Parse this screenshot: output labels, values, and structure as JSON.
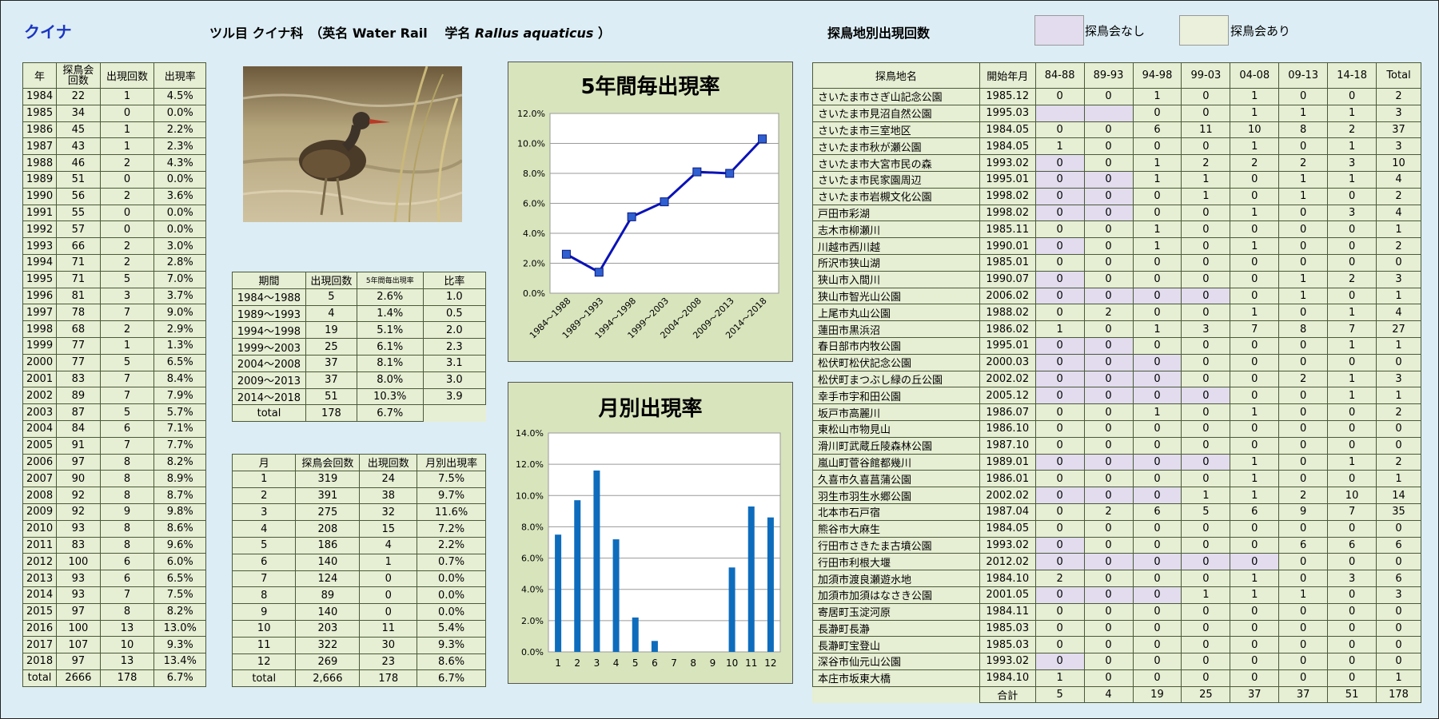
{
  "species_name": "クイナ",
  "header_prefix": "ツル目 クイナ科　（英名 Water Rail　 学名 ",
  "scientific_name": "Rallus aquaticus",
  "header_suffix": " ）",
  "site_section_title": "探鳥地別出現回数",
  "legend": {
    "no_event": "探鳥会なし",
    "event": "探鳥会あり",
    "no_event_color": "#e2dcee",
    "event_color": "#eaf0dc"
  },
  "photo_alt": "Water Rail photo",
  "year_table": {
    "headers": [
      "年",
      "探鳥会回数",
      "出現回数",
      "出現率"
    ],
    "rows": [
      [
        "1984",
        "22",
        "1",
        "4.5%"
      ],
      [
        "1985",
        "34",
        "0",
        "0.0%"
      ],
      [
        "1986",
        "45",
        "1",
        "2.2%"
      ],
      [
        "1987",
        "43",
        "1",
        "2.3%"
      ],
      [
        "1988",
        "46",
        "2",
        "4.3%"
      ],
      [
        "1989",
        "51",
        "0",
        "0.0%"
      ],
      [
        "1990",
        "56",
        "2",
        "3.6%"
      ],
      [
        "1991",
        "55",
        "0",
        "0.0%"
      ],
      [
        "1992",
        "57",
        "0",
        "0.0%"
      ],
      [
        "1993",
        "66",
        "2",
        "3.0%"
      ],
      [
        "1994",
        "71",
        "2",
        "2.8%"
      ],
      [
        "1995",
        "71",
        "5",
        "7.0%"
      ],
      [
        "1996",
        "81",
        "3",
        "3.7%"
      ],
      [
        "1997",
        "78",
        "7",
        "9.0%"
      ],
      [
        "1998",
        "68",
        "2",
        "2.9%"
      ],
      [
        "1999",
        "77",
        "1",
        "1.3%"
      ],
      [
        "2000",
        "77",
        "5",
        "6.5%"
      ],
      [
        "2001",
        "83",
        "7",
        "8.4%"
      ],
      [
        "2002",
        "89",
        "7",
        "7.9%"
      ],
      [
        "2003",
        "87",
        "5",
        "5.7%"
      ],
      [
        "2004",
        "84",
        "6",
        "7.1%"
      ],
      [
        "2005",
        "91",
        "7",
        "7.7%"
      ],
      [
        "2006",
        "97",
        "8",
        "8.2%"
      ],
      [
        "2007",
        "90",
        "8",
        "8.9%"
      ],
      [
        "2008",
        "92",
        "8",
        "8.7%"
      ],
      [
        "2009",
        "92",
        "9",
        "9.8%"
      ],
      [
        "2010",
        "93",
        "8",
        "8.6%"
      ],
      [
        "2011",
        "83",
        "8",
        "9.6%"
      ],
      [
        "2012",
        "100",
        "6",
        "6.0%"
      ],
      [
        "2013",
        "93",
        "6",
        "6.5%"
      ],
      [
        "2014",
        "93",
        "7",
        "7.5%"
      ],
      [
        "2015",
        "97",
        "8",
        "8.2%"
      ],
      [
        "2016",
        "100",
        "13",
        "13.0%"
      ],
      [
        "2017",
        "107",
        "10",
        "9.3%"
      ],
      [
        "2018",
        "97",
        "13",
        "13.4%"
      ]
    ],
    "total": [
      "total",
      "2666",
      "178",
      "6.7%"
    ]
  },
  "period_table": {
    "headers": [
      "期間",
      "出現回数",
      "5年間毎出現率",
      "比率"
    ],
    "rows": [
      [
        "1984～1988",
        "5",
        "2.6%",
        "1.0"
      ],
      [
        "1989～1993",
        "4",
        "1.4%",
        "0.5"
      ],
      [
        "1994～1998",
        "19",
        "5.1%",
        "2.0"
      ],
      [
        "1999～2003",
        "25",
        "6.1%",
        "2.3"
      ],
      [
        "2004～2008",
        "37",
        "8.1%",
        "3.1"
      ],
      [
        "2009～2013",
        "37",
        "8.0%",
        "3.0"
      ],
      [
        "2014～2018",
        "51",
        "10.3%",
        "3.9"
      ]
    ],
    "total": [
      "total",
      "178",
      "6.7%"
    ]
  },
  "month_table": {
    "headers": [
      "月",
      "探鳥会回数",
      "出現回数",
      "月別出現率"
    ],
    "rows": [
      [
        "1",
        "319",
        "24",
        "7.5%"
      ],
      [
        "2",
        "391",
        "38",
        "9.7%"
      ],
      [
        "3",
        "275",
        "32",
        "11.6%"
      ],
      [
        "4",
        "208",
        "15",
        "7.2%"
      ],
      [
        "5",
        "186",
        "4",
        "2.2%"
      ],
      [
        "6",
        "140",
        "1",
        "0.7%"
      ],
      [
        "7",
        "124",
        "0",
        "0.0%"
      ],
      [
        "8",
        "89",
        "0",
        "0.0%"
      ],
      [
        "9",
        "140",
        "0",
        "0.0%"
      ],
      [
        "10",
        "203",
        "11",
        "5.4%"
      ],
      [
        "11",
        "322",
        "30",
        "9.3%"
      ],
      [
        "12",
        "269",
        "23",
        "8.6%"
      ]
    ],
    "total": [
      "total",
      "2,666",
      "178",
      "6.7%"
    ]
  },
  "site_table": {
    "headers": [
      "探鳥地名",
      "開始年月",
      "84-88",
      "89-93",
      "94-98",
      "99-03",
      "04-08",
      "09-13",
      "14-18",
      "Total"
    ],
    "rows": [
      {
        "c": [
          "さいたま市さぎ山記念公園",
          "1985.12",
          "0",
          "0",
          "1",
          "0",
          "1",
          "0",
          "0",
          "2"
        ],
        "lav": []
      },
      {
        "c": [
          "さいたま市見沼自然公園",
          "1995.03",
          "",
          "",
          "0",
          "0",
          "1",
          "1",
          "1",
          "3"
        ],
        "lav": [
          2,
          3
        ]
      },
      {
        "c": [
          "さいたま市三室地区",
          "1984.05",
          "0",
          "0",
          "6",
          "11",
          "10",
          "8",
          "2",
          "37"
        ],
        "lav": []
      },
      {
        "c": [
          "さいたま市秋が瀬公園",
          "1984.05",
          "1",
          "0",
          "0",
          "0",
          "1",
          "0",
          "1",
          "3"
        ],
        "lav": []
      },
      {
        "c": [
          "さいたま市大宮市民の森",
          "1993.02",
          "0",
          "0",
          "1",
          "2",
          "2",
          "2",
          "3",
          "10"
        ],
        "lav": [
          2
        ]
      },
      {
        "c": [
          "さいたま市民家園周辺",
          "1995.01",
          "0",
          "0",
          "1",
          "1",
          "0",
          "1",
          "1",
          "4"
        ],
        "lav": [
          2,
          3
        ]
      },
      {
        "c": [
          "さいたま市岩槻文化公園",
          "1998.02",
          "0",
          "0",
          "0",
          "1",
          "0",
          "1",
          "0",
          "2"
        ],
        "lav": [
          2,
          3
        ]
      },
      {
        "c": [
          "戸田市彩湖",
          "1998.02",
          "0",
          "0",
          "0",
          "0",
          "1",
          "0",
          "3",
          "4"
        ],
        "lav": [
          2,
          3
        ]
      },
      {
        "c": [
          "志木市柳瀬川",
          "1985.11",
          "0",
          "0",
          "1",
          "0",
          "0",
          "0",
          "0",
          "1"
        ],
        "lav": []
      },
      {
        "c": [
          "川越市西川越",
          "1990.01",
          "0",
          "0",
          "1",
          "0",
          "1",
          "0",
          "0",
          "2"
        ],
        "lav": [
          2
        ]
      },
      {
        "c": [
          "所沢市狭山湖",
          "1985.01",
          "0",
          "0",
          "0",
          "0",
          "0",
          "0",
          "0",
          "0"
        ],
        "lav": []
      },
      {
        "c": [
          "狭山市入間川",
          "1990.07",
          "0",
          "0",
          "0",
          "0",
          "0",
          "1",
          "2",
          "3"
        ],
        "lav": [
          2
        ]
      },
      {
        "c": [
          "狭山市智光山公園",
          "2006.02",
          "0",
          "0",
          "0",
          "0",
          "0",
          "1",
          "0",
          "1"
        ],
        "lav": [
          2,
          3,
          4,
          5
        ]
      },
      {
        "c": [
          "上尾市丸山公園",
          "1988.02",
          "0",
          "2",
          "0",
          "0",
          "1",
          "0",
          "1",
          "4"
        ],
        "lav": []
      },
      {
        "c": [
          "蓮田市黒浜沼",
          "1986.02",
          "1",
          "0",
          "1",
          "3",
          "7",
          "8",
          "7",
          "27"
        ],
        "lav": []
      },
      {
        "c": [
          "春日部市内牧公園",
          "1995.01",
          "0",
          "0",
          "0",
          "0",
          "0",
          "0",
          "1",
          "1"
        ],
        "lav": [
          2,
          3
        ]
      },
      {
        "c": [
          "松伏町松伏記念公園",
          "2000.03",
          "0",
          "0",
          "0",
          "0",
          "0",
          "0",
          "0",
          "0"
        ],
        "lav": [
          2,
          3,
          4
        ]
      },
      {
        "c": [
          "松伏町まつぶし緑の丘公園",
          "2002.02",
          "0",
          "0",
          "0",
          "0",
          "0",
          "2",
          "1",
          "3"
        ],
        "lav": [
          2,
          3,
          4
        ]
      },
      {
        "c": [
          "幸手市宇和田公園",
          "2005.12",
          "0",
          "0",
          "0",
          "0",
          "0",
          "0",
          "1",
          "1"
        ],
        "lav": [
          2,
          3,
          4,
          5
        ]
      },
      {
        "c": [
          "坂戸市高麗川",
          "1986.07",
          "0",
          "0",
          "1",
          "0",
          "1",
          "0",
          "0",
          "2"
        ],
        "lav": []
      },
      {
        "c": [
          "東松山市物見山",
          "1986.10",
          "0",
          "0",
          "0",
          "0",
          "0",
          "0",
          "0",
          "0"
        ],
        "lav": []
      },
      {
        "c": [
          "滑川町武蔵丘陵森林公園",
          "1987.10",
          "0",
          "0",
          "0",
          "0",
          "0",
          "0",
          "0",
          "0"
        ],
        "lav": []
      },
      {
        "c": [
          "嵐山町菅谷館都幾川",
          "1989.01",
          "0",
          "0",
          "0",
          "0",
          "1",
          "0",
          "1",
          "2"
        ],
        "lav": [
          2,
          3,
          4,
          5
        ]
      },
      {
        "c": [
          "久喜市久喜菖蒲公園",
          "1986.01",
          "0",
          "0",
          "0",
          "0",
          "1",
          "0",
          "0",
          "1"
        ],
        "lav": []
      },
      {
        "c": [
          "羽生市羽生水郷公園",
          "2002.02",
          "0",
          "0",
          "0",
          "1",
          "1",
          "2",
          "10",
          "14"
        ],
        "lav": [
          2,
          3,
          4
        ]
      },
      {
        "c": [
          "北本市石戸宿",
          "1987.04",
          "0",
          "2",
          "6",
          "5",
          "6",
          "9",
          "7",
          "35"
        ],
        "lav": []
      },
      {
        "c": [
          "熊谷市大麻生",
          "1984.05",
          "0",
          "0",
          "0",
          "0",
          "0",
          "0",
          "0",
          "0"
        ],
        "lav": []
      },
      {
        "c": [
          "行田市さきたま古墳公園",
          "1993.02",
          "0",
          "0",
          "0",
          "0",
          "0",
          "6",
          "6",
          "6"
        ],
        "lav": [
          2
        ]
      },
      {
        "c": [
          "行田市利根大堰",
          "2012.02",
          "0",
          "0",
          "0",
          "0",
          "0",
          "0",
          "0",
          "0"
        ],
        "lav": [
          2,
          3,
          4,
          5,
          6
        ]
      },
      {
        "c": [
          "加須市渡良瀬遊水地",
          "1984.10",
          "2",
          "0",
          "0",
          "0",
          "1",
          "0",
          "3",
          "6"
        ],
        "lav": []
      },
      {
        "c": [
          "加須市加須はなさき公園",
          "2001.05",
          "0",
          "0",
          "0",
          "1",
          "1",
          "1",
          "0",
          "3"
        ],
        "lav": [
          2,
          3,
          4
        ]
      },
      {
        "c": [
          "寄居町玉淀河原",
          "1984.11",
          "0",
          "0",
          "0",
          "0",
          "0",
          "0",
          "0",
          "0"
        ],
        "lav": []
      },
      {
        "c": [
          "長瀞町長瀞",
          "1985.03",
          "0",
          "0",
          "0",
          "0",
          "0",
          "0",
          "0",
          "0"
        ],
        "lav": []
      },
      {
        "c": [
          "長瀞町宝登山",
          "1985.03",
          "0",
          "0",
          "0",
          "0",
          "0",
          "0",
          "0",
          "0"
        ],
        "lav": []
      },
      {
        "c": [
          "深谷市仙元山公園",
          "1993.02",
          "0",
          "0",
          "0",
          "0",
          "0",
          "0",
          "0",
          "0"
        ],
        "lav": [
          2
        ]
      },
      {
        "c": [
          "本庄市坂東大橋",
          "1984.10",
          "1",
          "0",
          "0",
          "0",
          "0",
          "0",
          "0",
          "1"
        ],
        "lav": []
      }
    ],
    "total": [
      "合計",
      "5",
      "4",
      "19",
      "25",
      "37",
      "37",
      "51",
      "178"
    ]
  },
  "chart_data": [
    {
      "type": "line",
      "title": "5年間毎出現率",
      "categories": [
        "1984～1988",
        "1989～1993",
        "1994～1998",
        "1999～2003",
        "2004～2008",
        "2009～2013",
        "2014～2018"
      ],
      "values": [
        2.6,
        1.4,
        5.1,
        6.1,
        8.1,
        8.0,
        10.3
      ],
      "ylim": [
        0,
        12
      ],
      "ytick_step": 2,
      "yticks_format": "percent1",
      "color": "#0a12b8",
      "grid": true
    },
    {
      "type": "bar",
      "title": "月別出現率",
      "categories": [
        "1",
        "2",
        "3",
        "4",
        "5",
        "6",
        "7",
        "8",
        "9",
        "10",
        "11",
        "12"
      ],
      "values": [
        7.5,
        9.7,
        11.6,
        7.2,
        2.2,
        0.7,
        0.0,
        0.0,
        0.0,
        5.4,
        9.3,
        8.6
      ],
      "ylim": [
        0,
        14
      ],
      "ytick_step": 2,
      "yticks_format": "percent1",
      "color": "#0e6cbd",
      "grid": true
    }
  ]
}
